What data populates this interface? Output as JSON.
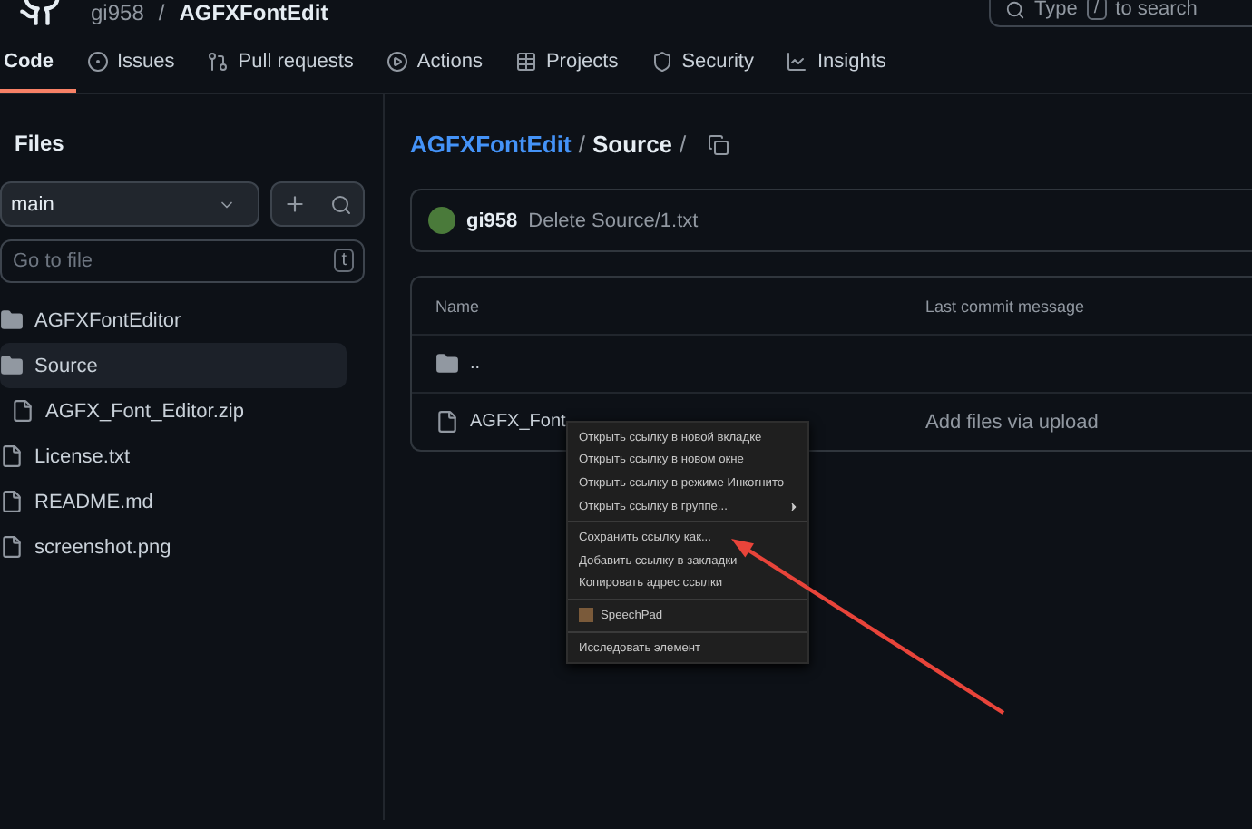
{
  "header": {
    "owner": "gi958",
    "separator": "/",
    "repo": "AGFXFontEdit",
    "search": {
      "placeholder_before": "Type",
      "key": "/",
      "placeholder_after": "to search"
    }
  },
  "tabs": [
    {
      "label": "Code",
      "selected": true
    },
    {
      "label": "Issues",
      "selected": false
    },
    {
      "label": "Pull requests",
      "selected": false
    },
    {
      "label": "Actions",
      "selected": false
    },
    {
      "label": "Projects",
      "selected": false
    },
    {
      "label": "Security",
      "selected": false
    },
    {
      "label": "Insights",
      "selected": false
    }
  ],
  "sidebar": {
    "title": "Files",
    "branch": "main",
    "goto": {
      "placeholder": "Go to file",
      "key": "t"
    },
    "items": [
      {
        "name": "AGFXFontEditor",
        "kind": "folder",
        "selected": false
      },
      {
        "name": "Source",
        "kind": "folder",
        "selected": true,
        "children": [
          {
            "name": "AGFX_Font_Editor.zip",
            "kind": "file",
            "selected": false
          }
        ]
      },
      {
        "name": "License.txt",
        "kind": "file",
        "selected": false
      },
      {
        "name": "README.md",
        "kind": "file",
        "selected": false
      },
      {
        "name": "screenshot.png",
        "kind": "file",
        "selected": false
      }
    ]
  },
  "breadcrumb": {
    "repo": "AGFXFontEdit",
    "separator": "/",
    "folder": "Source",
    "trail": "/"
  },
  "commit": {
    "author": "gi958",
    "message": "Delete Source/1.txt"
  },
  "table": {
    "columns": [
      "Name",
      "Last commit message"
    ],
    "rows": [
      {
        "kind": "folder",
        "name": ".."
      },
      {
        "kind": "file",
        "name": "AGFX_Font",
        "message": "Add files via upload"
      }
    ]
  },
  "context_menu": {
    "items": [
      {
        "kind": "item",
        "label": "Открыть ссылку в новой вкладке",
        "submenu": false
      },
      {
        "kind": "item",
        "label": "Открыть ссылку в новом окне",
        "submenu": false
      },
      {
        "kind": "item",
        "label": "Открыть ссылку в режиме Инкогнито",
        "submenu": false
      },
      {
        "kind": "item",
        "label": "Открыть ссылку в группе...",
        "submenu": true
      },
      {
        "kind": "separator"
      },
      {
        "kind": "item",
        "label": "Сохранить ссылку как...",
        "submenu": false
      },
      {
        "kind": "item",
        "label": "Добавить ссылку в закладки",
        "submenu": false
      },
      {
        "kind": "item",
        "label": "Копировать адрес ссылки",
        "submenu": false
      },
      {
        "kind": "separator"
      },
      {
        "kind": "extension",
        "label": "SpeechPad",
        "submenu": false
      },
      {
        "kind": "separator"
      },
      {
        "kind": "item",
        "label": "Исследовать элемент",
        "submenu": false
      }
    ]
  }
}
